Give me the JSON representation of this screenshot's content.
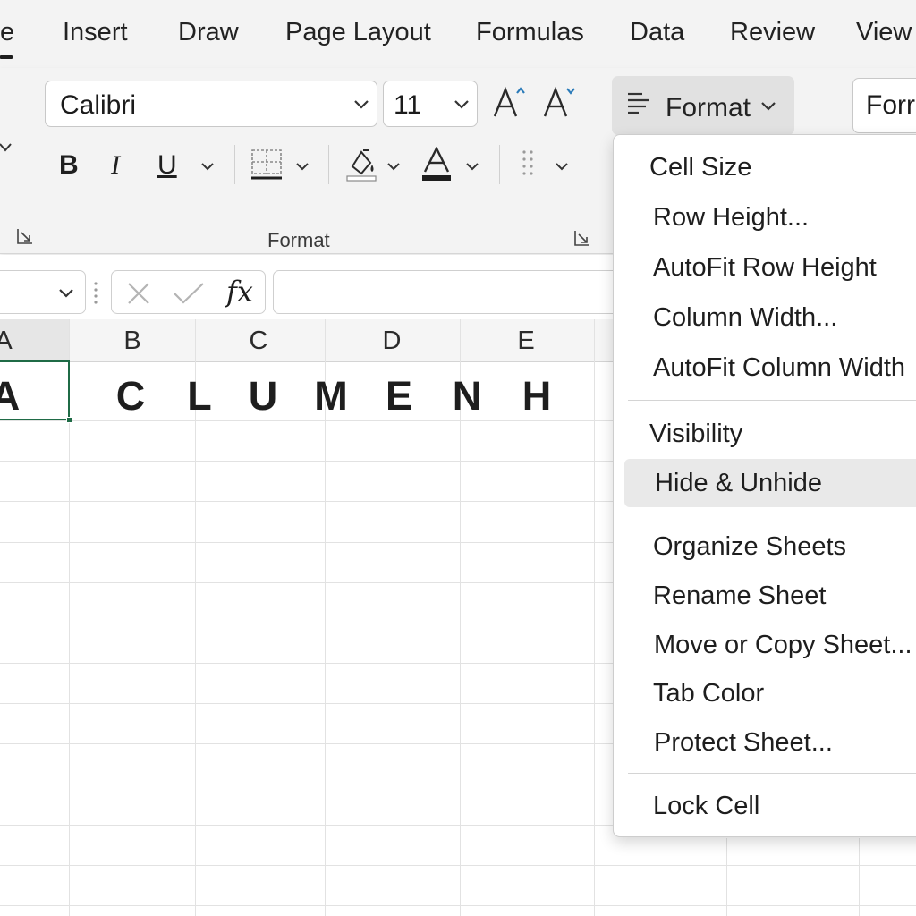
{
  "ribbon_tabs": {
    "partial_first": "e",
    "insert": "Insert",
    "draw": "Draw",
    "page_layout": "Page Layout",
    "formulas": "Formulas",
    "data": "Data",
    "review": "Review",
    "view": "View"
  },
  "font": {
    "family_value": "Calibri",
    "size_value": "11",
    "bold_label": "B",
    "italic_label": "I",
    "underline_label": "U",
    "group_label": "Format"
  },
  "cells_group": {
    "format_button_label": "Format",
    "style_field_partial": "Forr"
  },
  "formula_bar": {
    "fx_label": "fx"
  },
  "sheet": {
    "column_headers": [
      "A",
      "B",
      "C",
      "D",
      "E"
    ],
    "row1_cells": [
      "A",
      "C",
      "L",
      "U",
      "M",
      "E",
      "N",
      "H"
    ]
  },
  "format_menu": {
    "cell_size_heading": "Cell Size",
    "row_height": "Row Height...",
    "autofit_row_height": "AutoFit Row Height",
    "column_width": "Column Width...",
    "autofit_column_width": "AutoFit Column Width",
    "visibility_heading": "Visibility",
    "hide_unhide": "Hide & Unhide",
    "organize_sheets_heading": "Organize Sheets",
    "rename_sheet": "Rename Sheet",
    "move_copy_sheet": "Move or Copy Sheet...",
    "tab_color": "Tab Color",
    "protect_sheet": "Protect Sheet...",
    "lock_cell": "Lock Cell"
  },
  "colors": {
    "active_cell_border": "#1f6b46",
    "accent_blue": "#2b7bb9"
  }
}
